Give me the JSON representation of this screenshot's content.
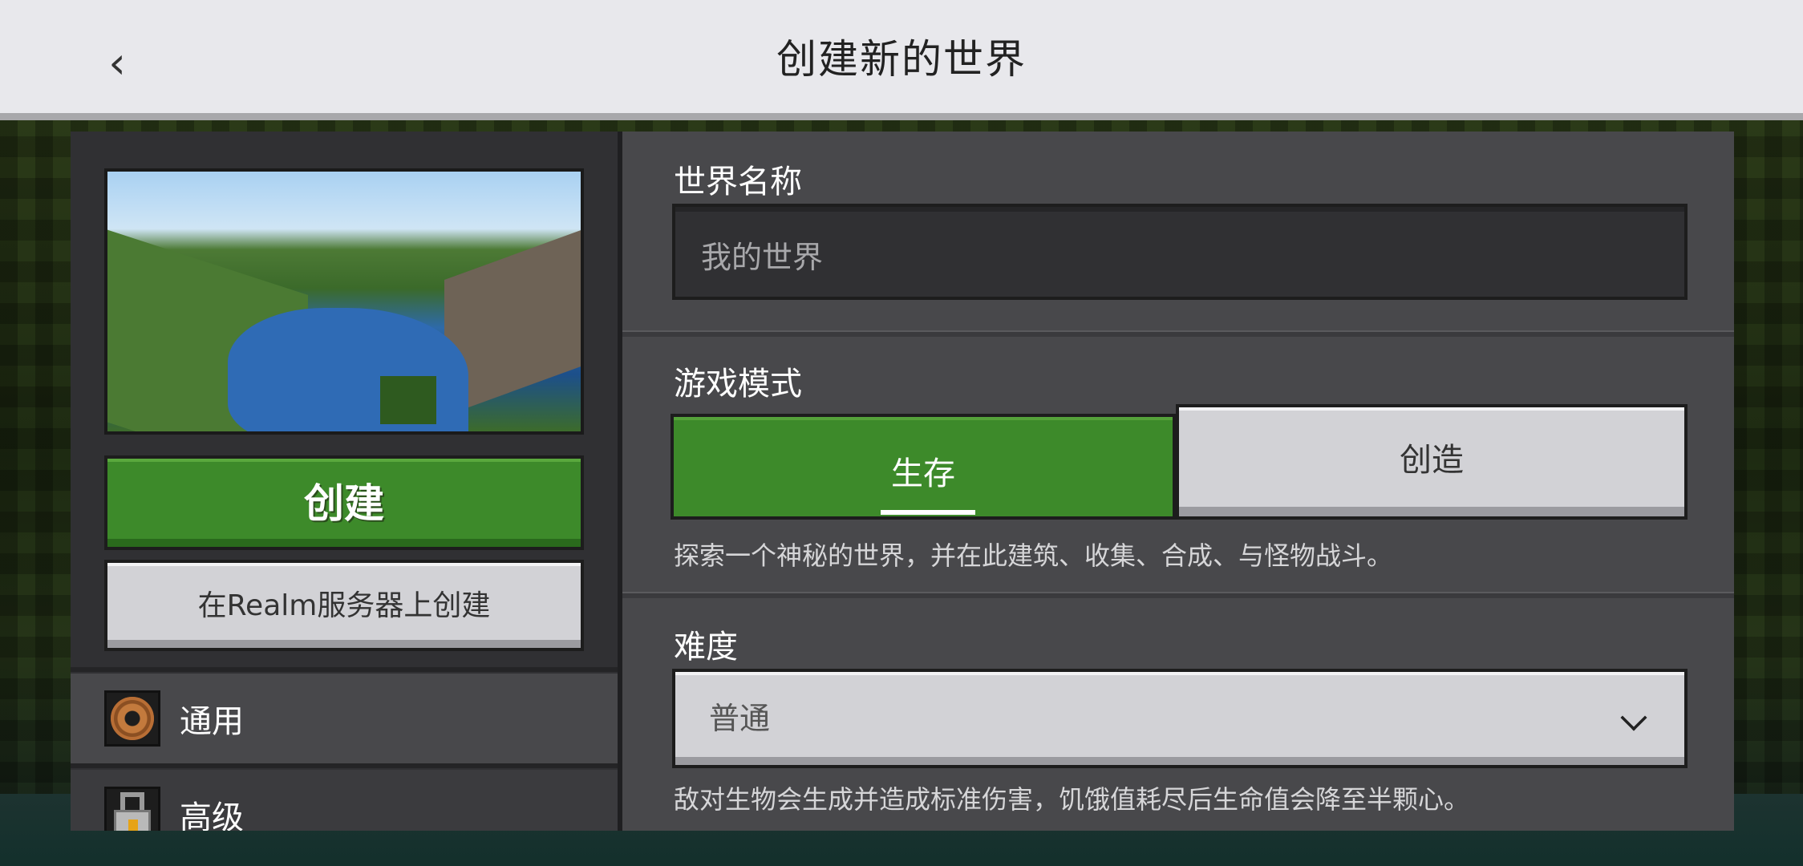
{
  "header": {
    "back_icon": "chevron-left-icon",
    "title": "创建新的世界"
  },
  "left_panel": {
    "create_button": "创建",
    "realm_button": "在Realm服务器上创建",
    "nav": [
      {
        "label": "通用",
        "icon": "gear-icon"
      },
      {
        "label": "高级",
        "icon": "lock-icon"
      }
    ]
  },
  "world_name": {
    "label": "世界名称",
    "placeholder": "我的世界"
  },
  "game_mode": {
    "label": "游戏模式",
    "options": [
      {
        "label": "生存",
        "selected": true
      },
      {
        "label": "创造",
        "selected": false
      }
    ],
    "description": "探索一个神秘的世界，并在此建筑、收集、合成、与怪物战斗。"
  },
  "difficulty": {
    "label": "难度",
    "selected": "普通",
    "description": "敌对生物会生成并造成标准伤害，饥饿值耗尽后生命值会降至半颗心。"
  },
  "colors": {
    "accent_green": "#3d8a2a",
    "panel": "#48484b",
    "header": "#e8e8ec"
  }
}
